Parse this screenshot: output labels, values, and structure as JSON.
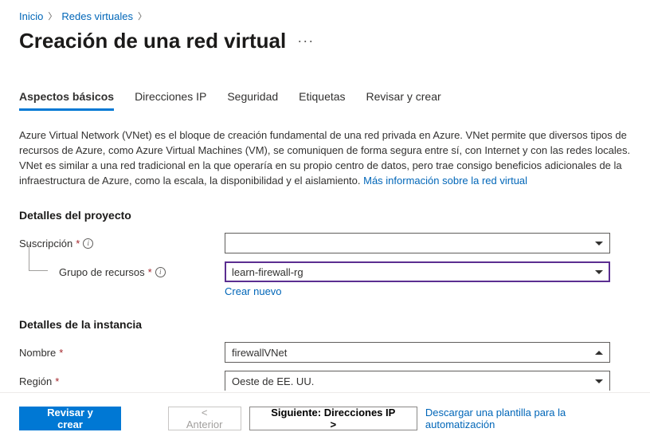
{
  "breadcrumb": {
    "home": "Inicio",
    "vnets": "Redes virtuales"
  },
  "page_title": "Creación de una red virtual",
  "tabs": {
    "basics": "Aspectos básicos",
    "ip": "Direcciones IP",
    "security": "Seguridad",
    "tags": "Etiquetas",
    "review": "Revisar y crear"
  },
  "description": {
    "text": "Azure Virtual Network (VNet) es el bloque de creación fundamental de una red privada en Azure. VNet permite que diversos tipos de recursos de Azure, como Azure Virtual Machines (VM), se comuniquen de forma segura entre sí, con Internet y con las redes locales. VNet es similar a una red tradicional en la que operaría en su propio centro de datos, pero trae consigo beneficios adicionales de la infraestructura de Azure, como la escala, la disponibilidad y el aislamiento. ",
    "link": "Más información sobre la red virtual"
  },
  "sections": {
    "project": "Detalles del proyecto",
    "instance": "Detalles de la instancia"
  },
  "fields": {
    "subscription_label": "Suscripción",
    "subscription_value": "",
    "rg_label": "Grupo de recursos",
    "rg_value": "learn-firewall-rg",
    "create_new": "Crear nuevo",
    "name_label": "Nombre",
    "name_value": "firewallVNet",
    "region_label": "Región",
    "region_value": "Oeste de EE. UU."
  },
  "footer": {
    "review": "Revisar y crear",
    "prev": "<  Anterior",
    "next": "Siguiente: Direcciones IP  >",
    "download": "Descargar una plantilla para la automatización"
  }
}
